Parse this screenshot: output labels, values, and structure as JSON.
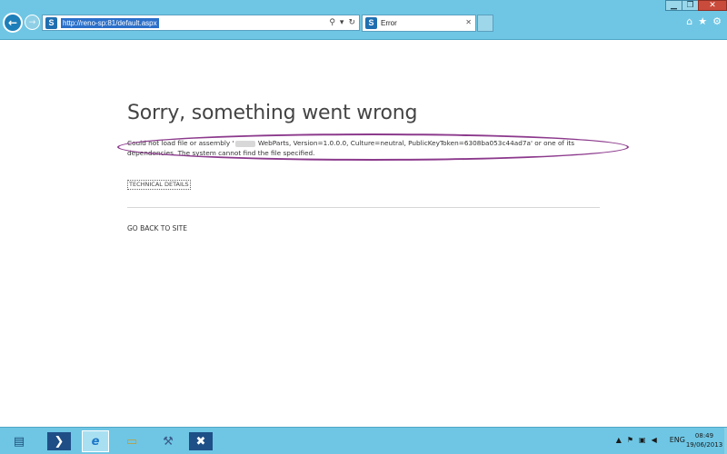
{
  "browser": {
    "window_controls": {
      "minimize": "▁",
      "maximize": "❐",
      "close": "✕"
    },
    "back_icon": "arrow-left-icon",
    "forward_icon": "arrow-right-icon",
    "url": "http://reno-sp:81/default.aspx",
    "address_tools": {
      "search": "⚲",
      "dropdown": "▾",
      "refresh": "↻"
    },
    "tab": {
      "title": "Error",
      "close": "✕"
    },
    "favicon": "S",
    "right_icons": {
      "home": "⌂",
      "favorites": "★",
      "settings": "⚙"
    }
  },
  "page": {
    "title": "Sorry, something went wrong",
    "message_part1": "Could not load file or assembly '",
    "message_part2": " WebParts, Version=1.0.0.0, Culture=neutral, PublicKeyToken=6308ba053c44ad7a' or one of its dependencies. The system cannot find the file specified.",
    "technical_details": "TECHNICAL DETAILS",
    "go_back": "GO BACK TO SITE",
    "highlight_color": "#8c3a8c"
  },
  "taskbar": {
    "apps": [
      {
        "name": "server-manager-icon",
        "glyph": "▤"
      },
      {
        "name": "powershell-icon",
        "glyph": "❯"
      },
      {
        "name": "internet-explorer-icon",
        "glyph": "e"
      },
      {
        "name": "file-explorer-icon",
        "glyph": "▭"
      },
      {
        "name": "sharepoint-config-icon",
        "glyph": "⚒"
      },
      {
        "name": "tools-icon",
        "glyph": "✖"
      }
    ],
    "tray": {
      "up_arrow": "▲",
      "flag": "⚑",
      "network": "▣",
      "volume": "◀",
      "language": "ENG"
    },
    "time": "08:49",
    "date": "19/06/2013"
  }
}
